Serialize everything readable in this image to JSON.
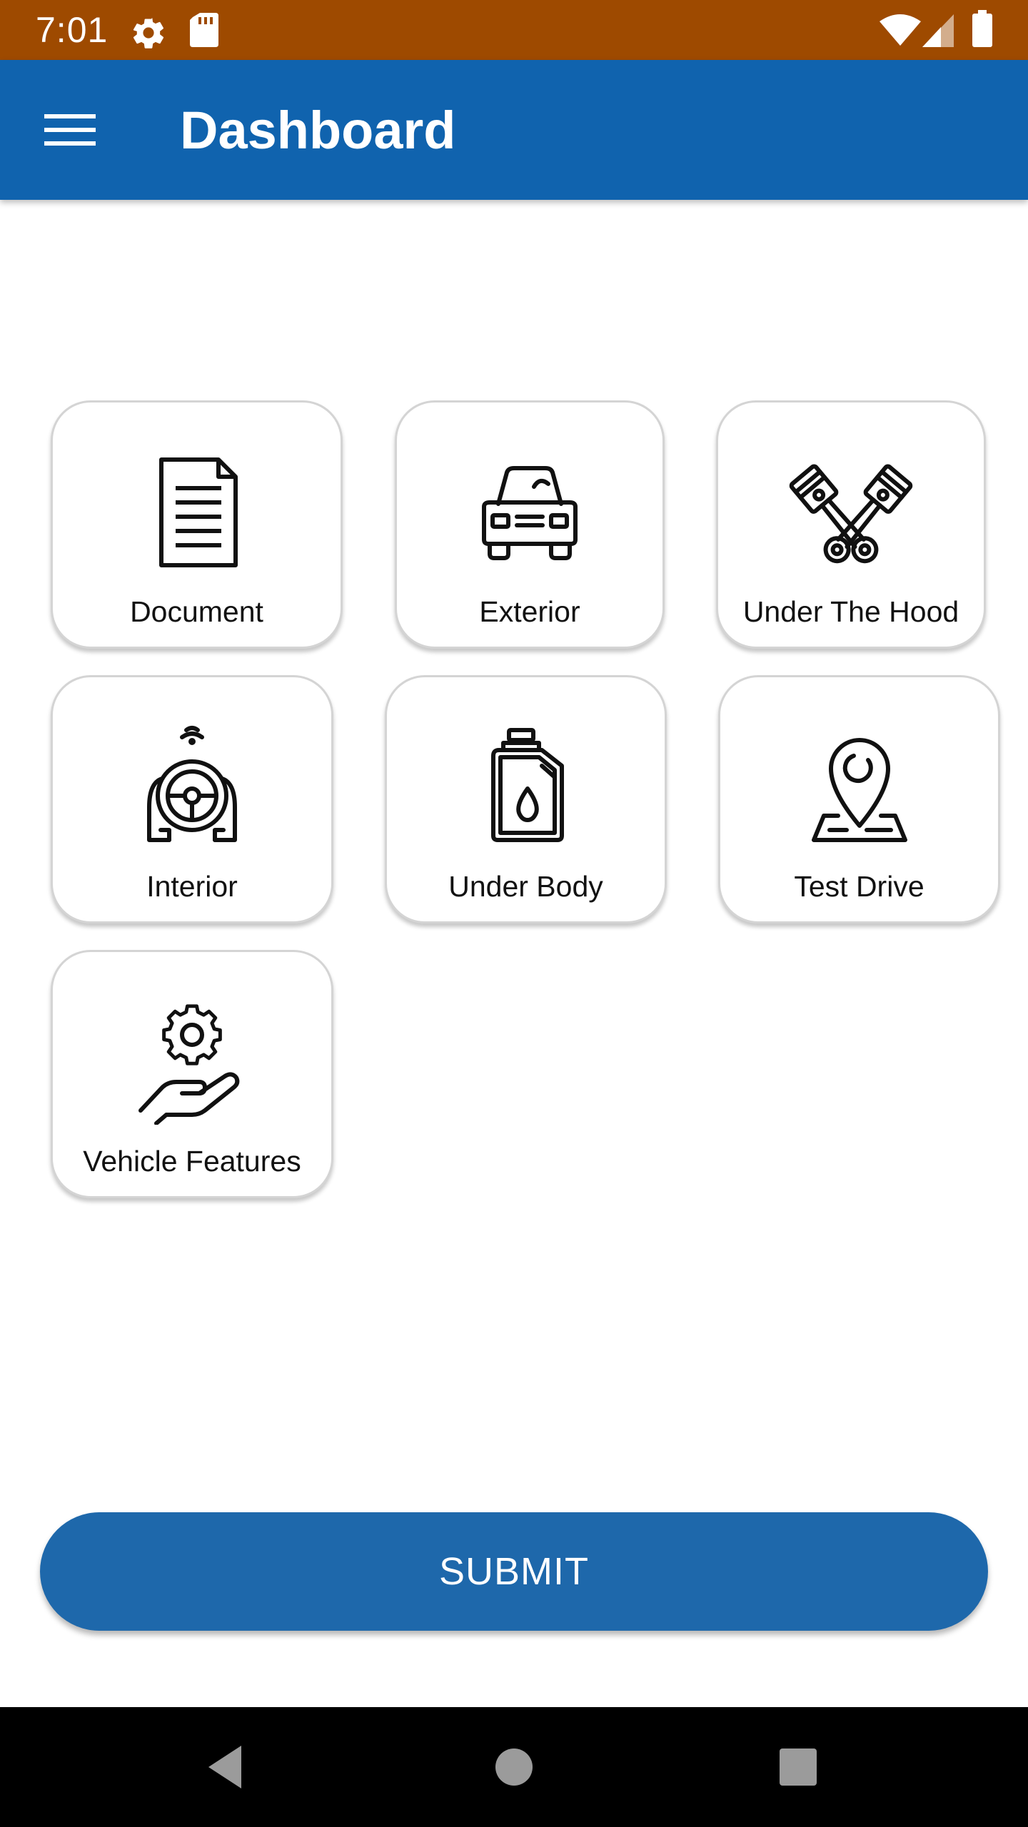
{
  "status_bar": {
    "time": "7:01",
    "icons": [
      "gear-icon",
      "sd-card-icon",
      "wifi-icon",
      "cell-signal-icon",
      "battery-icon"
    ],
    "background": "#9e4a00"
  },
  "app_bar": {
    "title": "Dashboard",
    "menu_icon": "hamburger-menu-icon",
    "background": "#1063ae"
  },
  "tiles": [
    {
      "label": "Document",
      "icon": "document-icon"
    },
    {
      "label": "Exterior",
      "icon": "car-icon"
    },
    {
      "label": "Under The Hood",
      "icon": "pistons-icon"
    },
    {
      "label": "Interior",
      "icon": "steering-wheel-icon"
    },
    {
      "label": "Under Body",
      "icon": "oil-can-icon"
    },
    {
      "label": "Test Drive",
      "icon": "map-pin-icon"
    },
    {
      "label": "Vehicle Features",
      "icon": "gear-hand-icon"
    }
  ],
  "submit": {
    "label": "SUBMIT",
    "color": "#1e68ab"
  },
  "nav_bar": {
    "icons": [
      "back-icon",
      "home-icon",
      "recents-icon"
    ]
  }
}
